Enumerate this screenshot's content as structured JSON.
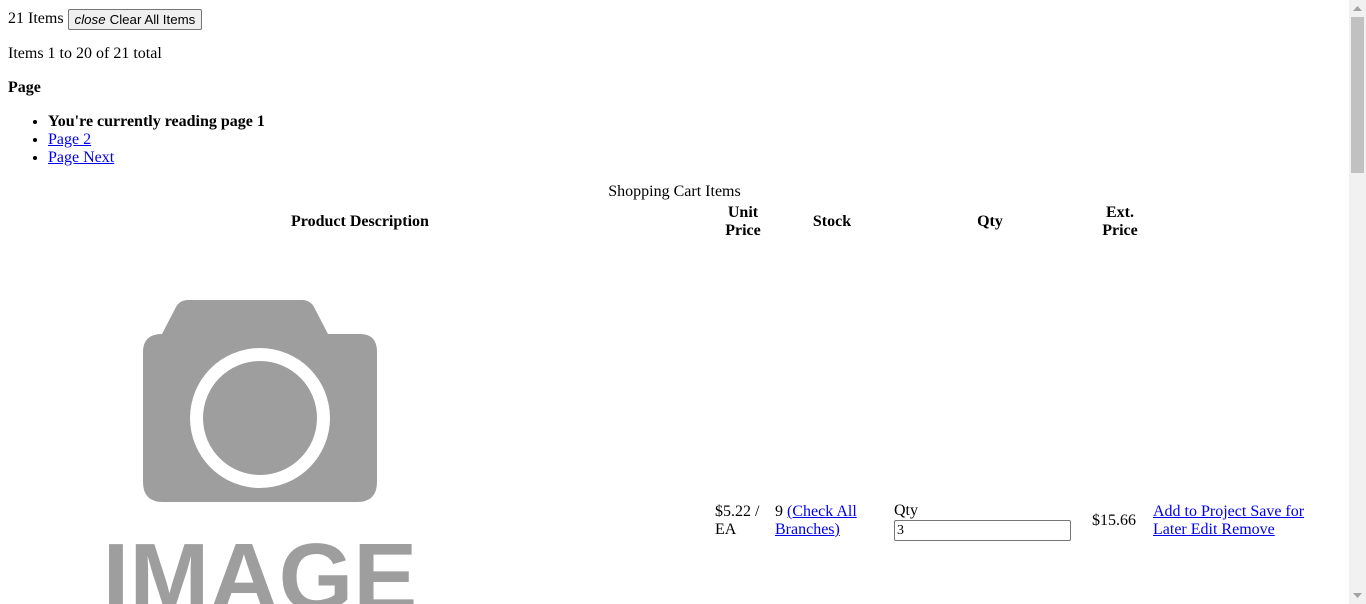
{
  "cart": {
    "item_count": "21 Items",
    "clear_icon": "close",
    "clear_label": "Clear All Items",
    "items_range": "Items 1 to 20 of 21 total"
  },
  "pagination": {
    "heading": "Page",
    "items": [
      {
        "label": "You're currently reading page 1",
        "current": true
      },
      {
        "label": "Page 2",
        "current": false
      },
      {
        "label": "Page Next",
        "current": false
      }
    ]
  },
  "table": {
    "caption": "Shopping Cart Items",
    "headers": {
      "product": "Product Description",
      "unit_price_1": "Unit",
      "unit_price_2": "Price",
      "stock": "Stock",
      "qty": "Qty",
      "ext_price_1": "Ext.",
      "ext_price_2": "Price"
    },
    "rows": [
      {
        "image_icon": "image-placeholder-icon",
        "image_text": "IMAGE",
        "unit_price_1": "$5.22 /",
        "unit_price_2": "EA",
        "stock_count": "9",
        "check_branches_1": "(Check All",
        "check_branches_2": "Branches)",
        "qty_label": "Qty",
        "qty_value": "3",
        "ext_price": "$15.66",
        "actions_1": "Add to Project Save for",
        "actions_2": "Later Edit Remove"
      }
    ]
  }
}
